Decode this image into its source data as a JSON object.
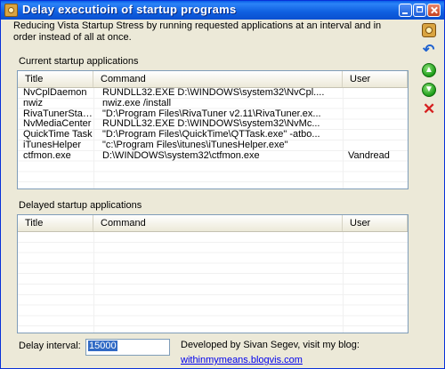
{
  "window": {
    "title": "Delay executioin of startup programs"
  },
  "description": "Reducing Vista Startup Stress by running requested applications at an interval and in order instead of all at once.",
  "current": {
    "label": "Current startup applications",
    "columns": [
      "Title",
      "Command",
      "User"
    ],
    "rows": [
      {
        "title": "NvCplDaemon",
        "command": "RUNDLL32.EXE D:\\WINDOWS\\system32\\NvCpl....",
        "user": ""
      },
      {
        "title": "nwiz",
        "command": "nwiz.exe /install",
        "user": ""
      },
      {
        "title": "RivaTunerStart...",
        "command": "\"D:\\Program Files\\RivaTuner v2.11\\RivaTuner.ex...",
        "user": ""
      },
      {
        "title": "NvMediaCenter",
        "command": "RUNDLL32.EXE D:\\WINDOWS\\system32\\NvMc...",
        "user": ""
      },
      {
        "title": "QuickTime Task",
        "command": "\"D:\\Program Files\\QuickTime\\QTTask.exe\" -atbo...",
        "user": ""
      },
      {
        "title": "iTunesHelper",
        "command": "\"c:\\Program Files\\itunes\\iTunesHelper.exe\"",
        "user": ""
      },
      {
        "title": "ctfmon.exe",
        "command": "D:\\WINDOWS\\system32\\ctfmon.exe",
        "user": "Vandread"
      }
    ]
  },
  "delayed": {
    "label": "Delayed startup applications",
    "columns": [
      "Title",
      "Command",
      "User"
    ],
    "rows": []
  },
  "footer": {
    "delay_label": "Delay interval:",
    "delay_value": "15000",
    "developer_text": "Developed by Sivan Segev, visit my blog:",
    "link": "withinmymeans.blogvis.com"
  },
  "toolbar": {
    "icons": [
      "settings-icon",
      "undo-icon",
      "move-up-icon",
      "move-down-icon",
      "delete-icon"
    ],
    "up_glyph": "▲",
    "down_glyph": "▼",
    "undo_glyph": "↶",
    "delete_glyph": "✕"
  }
}
